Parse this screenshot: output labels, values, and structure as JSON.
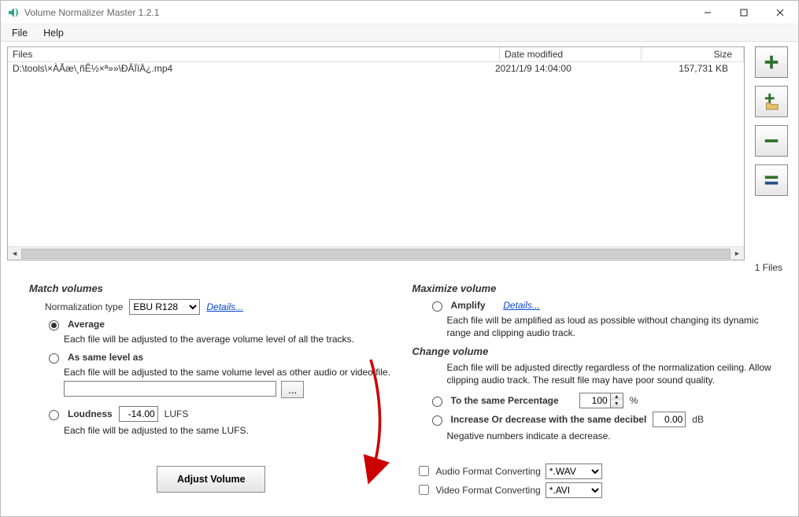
{
  "window": {
    "title": "Volume Normalizer Master 1.2.1"
  },
  "menu": {
    "file": "File",
    "help": "Help"
  },
  "list": {
    "cols": {
      "files": "Files",
      "date": "Date modified",
      "size": "Size"
    },
    "rows": [
      {
        "path": "D:\\tools\\×ÀÃæ\\¸ñÊ½×ª»»\\ÐÂÏîÄ¿.mp4",
        "date": "2021/1/9 14:04:00",
        "size": "157,731 KB"
      }
    ],
    "summary": "1 Files"
  },
  "side": {
    "add": "add",
    "add_folder": "add-folder",
    "remove": "remove",
    "clear": "clear"
  },
  "match": {
    "title": "Match volumes",
    "norm_label": "Normalization type",
    "norm_options": [
      "EBU R128"
    ],
    "details": "Details...",
    "average": "Average",
    "average_desc": "Each file will be adjusted to the average volume level of all the tracks.",
    "same_as": "As same level as",
    "same_as_desc": "Each file will be adjusted to the same volume level as other audio or video file.",
    "same_as_value": "",
    "browse": "...",
    "loudness": "Loudness",
    "loudness_value": "-14.00",
    "loudness_unit": "LUFS",
    "loudness_desc": "Each file will be adjusted to the same LUFS."
  },
  "max": {
    "title": "Maximize volume",
    "amplify": "Amplify",
    "details": "Details...",
    "amplify_desc": "Each file will be amplified as loud as possible without changing its dynamic range and clipping audio track."
  },
  "change": {
    "title": "Change volume",
    "desc": "Each file will be adjusted directly regardless of the normalization ceiling. Allow clipping audio track. The result file may have poor sound quality.",
    "pct_label": "To the same Percentage",
    "pct_value": "100",
    "pct_unit": "%",
    "db_label": "Increase Or decrease with the same decibel",
    "db_value": "0.00",
    "db_unit": "dB",
    "neg_note": "Negative numbers indicate a decrease."
  },
  "convert": {
    "audio_label": "Audio Format Converting",
    "audio_sel": "*.WAV",
    "video_label": "Video Format Converting",
    "video_sel": "*.AVI"
  },
  "adjust_label": "Adjust Volume"
}
